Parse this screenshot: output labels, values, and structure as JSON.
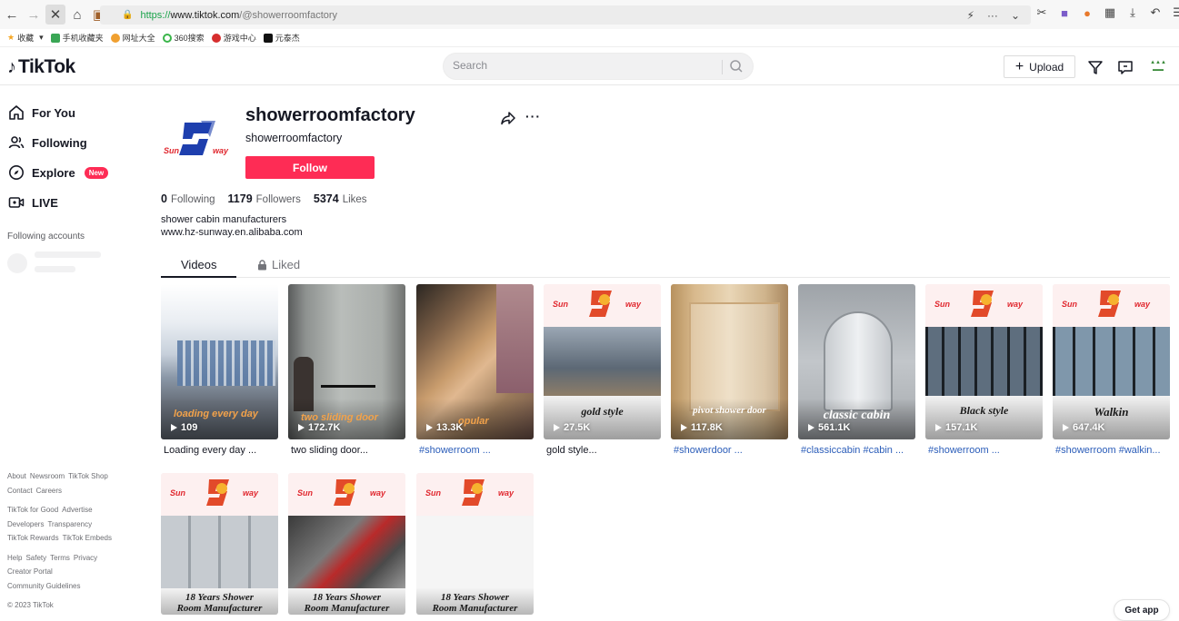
{
  "browser": {
    "url_scheme": "https://",
    "url_host": "www.tiktok.com",
    "url_path": "/@showerroomfactory",
    "bookmarks": [
      "收藏",
      "手机收藏夹",
      "网址大全",
      "360搜索",
      "游戏中心",
      "元泰杰"
    ]
  },
  "header": {
    "logo_text": "TikTok",
    "search_placeholder": "Search",
    "upload_label": "Upload"
  },
  "sidebar": {
    "items": [
      {
        "label": "For You",
        "icon": "home-icon"
      },
      {
        "label": "Following",
        "icon": "users-icon"
      },
      {
        "label": "Explore",
        "icon": "compass-icon",
        "badge": "New"
      },
      {
        "label": "LIVE",
        "icon": "live-icon"
      }
    ],
    "following_accounts_title": "Following accounts",
    "footer_rows": [
      [
        "About",
        "Newsroom",
        "TikTok Shop",
        "Contact",
        "Careers"
      ],
      [
        "TikTok for Good",
        "Advertise",
        "Developers",
        "Transparency",
        "TikTok Rewards",
        "TikTok Embeds"
      ],
      [
        "Help",
        "Safety",
        "Terms",
        "Privacy",
        "Creator Portal",
        "Community Guidelines"
      ]
    ],
    "copyright": "© 2023 TikTok"
  },
  "profile": {
    "username": "showerroomfactory",
    "nickname": "showerroomfactory",
    "follow_label": "Follow",
    "stats": {
      "following": "0",
      "following_label": "Following",
      "followers": "1179",
      "followers_label": "Followers",
      "likes": "5374",
      "likes_label": "Likes"
    },
    "bio_line1": "shower cabin manufacturers",
    "bio_line2": "www.hz-sunway.en.alibaba.com"
  },
  "tabs": {
    "videos": "Videos",
    "liked": "Liked"
  },
  "videos": [
    {
      "views": "109",
      "caption": "Loading every day ...",
      "overlay": "loading every day"
    },
    {
      "views": "172.7K",
      "caption": "two sliding door...",
      "overlay": "two sliding door"
    },
    {
      "views": "13.3K",
      "caption": "#showerroom ...",
      "overlay": "opular"
    },
    {
      "views": "27.5K",
      "caption": "gold style...",
      "overlay": "gold style"
    },
    {
      "views": "117.8K",
      "caption": "#showerdoor ...",
      "overlay": "pivot shower door"
    },
    {
      "views": "561.1K",
      "caption": "#classiccabin #cabin ...",
      "overlay": "classic cabin"
    },
    {
      "views": "157.1K",
      "caption": "#showerroom ...",
      "overlay": "Black style"
    },
    {
      "views": "647.4K",
      "caption": "#showerroom #walkin...",
      "overlay": "Walkin"
    },
    {
      "overlay_line1": "18 Years Shower",
      "overlay_line2": "Room Manufacturer"
    },
    {
      "overlay_line1": "18 Years Shower",
      "overlay_line2": "Room Manufacturer"
    },
    {
      "overlay_line1": "18 Years Shower",
      "overlay_line2": "Room Manufacturer"
    }
  ],
  "brand_sun": "Sun",
  "brand_way": "way",
  "get_app": "Get app",
  "colors": {
    "accent": "#fe2c55",
    "hashtag": "#2b5db9",
    "brand_red": "#e0262d",
    "brand_blue": "#1e3fae"
  }
}
